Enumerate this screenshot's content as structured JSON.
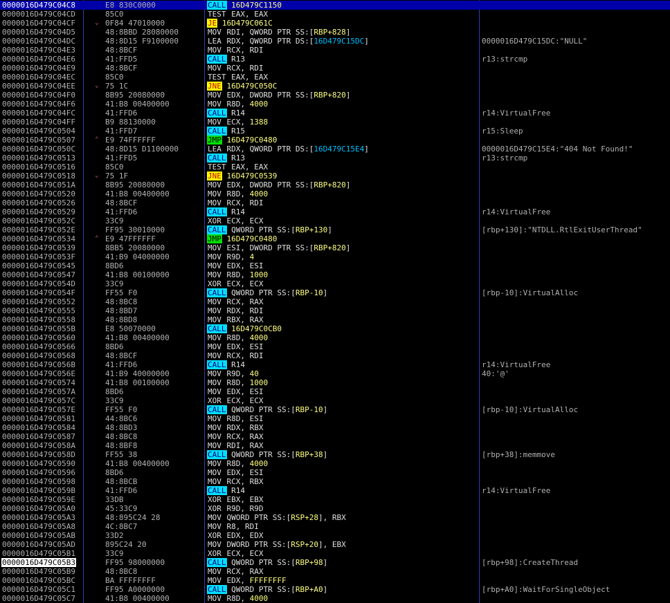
{
  "rows": [
    {
      "addr": "0000016D479C04C8",
      "arrow": "",
      "bytes": "E8 830C0000",
      "mn": "CALL",
      "mnType": "call",
      "ops": [
        {
          "t": "16D479C1150",
          "c": "jtgt"
        }
      ],
      "cmt": "",
      "selected": true
    },
    {
      "addr": "0000016D479C04CD",
      "arrow": "",
      "bytes": "85C0",
      "mn": "TEST",
      "mnType": "",
      "ops": [
        {
          "t": "EAX, EAX",
          "c": ""
        }
      ],
      "cmt": ""
    },
    {
      "addr": "0000016D479C04CF",
      "arrow": "v",
      "bytes": "0F84 47010000",
      "mn": "JE",
      "mnType": "jcc",
      "ops": [
        {
          "t": "16D479C061C",
          "c": "jtgt"
        }
      ],
      "cmt": ""
    },
    {
      "addr": "0000016D479C04D5",
      "arrow": "",
      "bytes": "48:8BBD 28080000",
      "mn": "MOV",
      "mnType": "",
      "ops": [
        {
          "t": "RDI, QWORD PTR SS:[",
          "c": ""
        },
        {
          "t": "RBP+828",
          "c": "num"
        },
        {
          "t": "]",
          "c": ""
        }
      ],
      "cmt": ""
    },
    {
      "addr": "0000016D479C04DC",
      "arrow": "",
      "bytes": "48:8D15 F9100000",
      "mn": "LEA",
      "mnType": "",
      "ops": [
        {
          "t": "RDX, QWORD PTR DS:[",
          "c": ""
        },
        {
          "t": "16D479C15DC",
          "c": "ref"
        },
        {
          "t": "]",
          "c": ""
        }
      ],
      "cmt": "0000016D479C15DC:\"NULL\""
    },
    {
      "addr": "0000016D479C04E3",
      "arrow": "",
      "bytes": "48:8BCF",
      "mn": "MOV",
      "mnType": "",
      "ops": [
        {
          "t": "RCX, RDI",
          "c": ""
        }
      ],
      "cmt": ""
    },
    {
      "addr": "0000016D479C04E6",
      "arrow": "",
      "bytes": "41:FFD5",
      "mn": "CALL",
      "mnType": "call",
      "ops": [
        {
          "t": "R13",
          "c": ""
        }
      ],
      "cmt": "r13:strcmp"
    },
    {
      "addr": "0000016D479C04E9",
      "arrow": "",
      "bytes": "48:8BCF",
      "mn": "MOV",
      "mnType": "",
      "ops": [
        {
          "t": "RCX, RDI",
          "c": ""
        }
      ],
      "cmt": ""
    },
    {
      "addr": "0000016D479C04EC",
      "arrow": "",
      "bytes": "85C0",
      "mn": "TEST",
      "mnType": "",
      "ops": [
        {
          "t": "EAX, EAX",
          "c": ""
        }
      ],
      "cmt": ""
    },
    {
      "addr": "0000016D479C04EE",
      "arrow": "v",
      "bytes": "75 1C",
      "mn": "JNE",
      "mnType": "jcc",
      "ops": [
        {
          "t": "16D479C050C",
          "c": "jtgt"
        }
      ],
      "cmt": ""
    },
    {
      "addr": "0000016D479C04F0",
      "arrow": "",
      "bytes": "8B95 20080000",
      "mn": "MOV",
      "mnType": "",
      "ops": [
        {
          "t": "EDX, DWORD PTR SS:[",
          "c": ""
        },
        {
          "t": "RBP+820",
          "c": "num"
        },
        {
          "t": "]",
          "c": ""
        }
      ],
      "cmt": ""
    },
    {
      "addr": "0000016D479C04F6",
      "arrow": "",
      "bytes": "41:B8 00400000",
      "mn": "MOV",
      "mnType": "",
      "ops": [
        {
          "t": "R8D, ",
          "c": ""
        },
        {
          "t": "4000",
          "c": "num"
        }
      ],
      "cmt": ""
    },
    {
      "addr": "0000016D479C04FC",
      "arrow": "",
      "bytes": "41:FFD6",
      "mn": "CALL",
      "mnType": "call",
      "ops": [
        {
          "t": "R14",
          "c": ""
        }
      ],
      "cmt": "r14:VirtualFree"
    },
    {
      "addr": "0000016D479C04FF",
      "arrow": "",
      "bytes": "B9 88130000",
      "mn": "MOV",
      "mnType": "",
      "ops": [
        {
          "t": "ECX, ",
          "c": ""
        },
        {
          "t": "1388",
          "c": "num"
        }
      ],
      "cmt": ""
    },
    {
      "addr": "0000016D479C0504",
      "arrow": "",
      "bytes": "41:FFD7",
      "mn": "CALL",
      "mnType": "call",
      "ops": [
        {
          "t": "R15",
          "c": ""
        }
      ],
      "cmt": "r15:Sleep"
    },
    {
      "addr": "0000016D479C0507",
      "arrow": "^",
      "bytes": "E9 74FFFFFF",
      "mn": "JMP",
      "mnType": "jmp",
      "ops": [
        {
          "t": "16D479C0480",
          "c": "jtgt"
        }
      ],
      "cmt": ""
    },
    {
      "addr": "0000016D479C050C",
      "arrow": "",
      "bytes": "48:8D15 D1100000",
      "mn": "LEA",
      "mnType": "",
      "ops": [
        {
          "t": "RDX, QWORD PTR DS:[",
          "c": ""
        },
        {
          "t": "16D479C15E4",
          "c": "ref"
        },
        {
          "t": "]",
          "c": ""
        }
      ],
      "cmt": "0000016D479C15E4:\"404 Not Found!\""
    },
    {
      "addr": "0000016D479C0513",
      "arrow": "",
      "bytes": "41:FFD5",
      "mn": "CALL",
      "mnType": "call",
      "ops": [
        {
          "t": "R13",
          "c": ""
        }
      ],
      "cmt": "r13:strcmp"
    },
    {
      "addr": "0000016D479C0516",
      "arrow": "",
      "bytes": "85C0",
      "mn": "TEST",
      "mnType": "",
      "ops": [
        {
          "t": "EAX, EAX",
          "c": ""
        }
      ],
      "cmt": ""
    },
    {
      "addr": "0000016D479C0518",
      "arrow": "v",
      "bytes": "75 1F",
      "mn": "JNE",
      "mnType": "jcc",
      "ops": [
        {
          "t": "16D479C0539",
          "c": "jtgt"
        }
      ],
      "cmt": ""
    },
    {
      "addr": "0000016D479C051A",
      "arrow": "",
      "bytes": "8B95 20080000",
      "mn": "MOV",
      "mnType": "",
      "ops": [
        {
          "t": "EDX, DWORD PTR SS:[",
          "c": ""
        },
        {
          "t": "RBP+820",
          "c": "num"
        },
        {
          "t": "]",
          "c": ""
        }
      ],
      "cmt": ""
    },
    {
      "addr": "0000016D479C0520",
      "arrow": "",
      "bytes": "41:B8 00400000",
      "mn": "MOV",
      "mnType": "",
      "ops": [
        {
          "t": "R8D, ",
          "c": ""
        },
        {
          "t": "4000",
          "c": "num"
        }
      ],
      "cmt": ""
    },
    {
      "addr": "0000016D479C0526",
      "arrow": "",
      "bytes": "48:8BCF",
      "mn": "MOV",
      "mnType": "",
      "ops": [
        {
          "t": "RCX, RDI",
          "c": ""
        }
      ],
      "cmt": ""
    },
    {
      "addr": "0000016D479C0529",
      "arrow": "",
      "bytes": "41:FFD6",
      "mn": "CALL",
      "mnType": "call",
      "ops": [
        {
          "t": "R14",
          "c": ""
        }
      ],
      "cmt": "r14:VirtualFree"
    },
    {
      "addr": "0000016D479C052C",
      "arrow": "",
      "bytes": "33C9",
      "mn": "XOR",
      "mnType": "",
      "ops": [
        {
          "t": "ECX, ECX",
          "c": ""
        }
      ],
      "cmt": ""
    },
    {
      "addr": "0000016D479C052E",
      "arrow": "",
      "bytes": "FF95 30010000",
      "mn": "CALL",
      "mnType": "call",
      "ops": [
        {
          "t": "QWORD PTR SS:[",
          "c": ""
        },
        {
          "t": "RBP+130",
          "c": "num"
        },
        {
          "t": "]",
          "c": ""
        }
      ],
      "cmt": "[rbp+130]:\"NTDLL.RtlExitUserThread\""
    },
    {
      "addr": "0000016D479C0534",
      "arrow": "^",
      "bytes": "E9 47FFFFFF",
      "mn": "JMP",
      "mnType": "jmp",
      "ops": [
        {
          "t": "16D479C0480",
          "c": "jtgt"
        }
      ],
      "cmt": ""
    },
    {
      "addr": "0000016D479C0539",
      "arrow": "",
      "bytes": "8BB5 20080000",
      "mn": "MOV",
      "mnType": "",
      "ops": [
        {
          "t": "ESI, DWORD PTR SS:[",
          "c": ""
        },
        {
          "t": "RBP+820",
          "c": "num"
        },
        {
          "t": "]",
          "c": ""
        }
      ],
      "cmt": ""
    },
    {
      "addr": "0000016D479C053F",
      "arrow": "",
      "bytes": "41:B9 04000000",
      "mn": "MOV",
      "mnType": "",
      "ops": [
        {
          "t": "R9D, ",
          "c": ""
        },
        {
          "t": "4",
          "c": "num"
        }
      ],
      "cmt": ""
    },
    {
      "addr": "0000016D479C0545",
      "arrow": "",
      "bytes": "8BD6",
      "mn": "MOV",
      "mnType": "",
      "ops": [
        {
          "t": "EDX, ESI",
          "c": ""
        }
      ],
      "cmt": ""
    },
    {
      "addr": "0000016D479C0547",
      "arrow": "",
      "bytes": "41:B8 00100000",
      "mn": "MOV",
      "mnType": "",
      "ops": [
        {
          "t": "R8D, ",
          "c": ""
        },
        {
          "t": "1000",
          "c": "num"
        }
      ],
      "cmt": ""
    },
    {
      "addr": "0000016D479C054D",
      "arrow": "",
      "bytes": "33C9",
      "mn": "XOR",
      "mnType": "",
      "ops": [
        {
          "t": "ECX, ECX",
          "c": ""
        }
      ],
      "cmt": ""
    },
    {
      "addr": "0000016D479C054F",
      "arrow": "",
      "bytes": "FF55 F0",
      "mn": "CALL",
      "mnType": "call",
      "ops": [
        {
          "t": "QWORD PTR SS:[",
          "c": ""
        },
        {
          "t": "RBP-10",
          "c": "num"
        },
        {
          "t": "]",
          "c": ""
        }
      ],
      "cmt": "[rbp-10]:VirtualAlloc"
    },
    {
      "addr": "0000016D479C0552",
      "arrow": "",
      "bytes": "48:8BC8",
      "mn": "MOV",
      "mnType": "",
      "ops": [
        {
          "t": "RCX, RAX",
          "c": ""
        }
      ],
      "cmt": ""
    },
    {
      "addr": "0000016D479C0555",
      "arrow": "",
      "bytes": "48:8BD7",
      "mn": "MOV",
      "mnType": "",
      "ops": [
        {
          "t": "RDX, RDI",
          "c": ""
        }
      ],
      "cmt": ""
    },
    {
      "addr": "0000016D479C0558",
      "arrow": "",
      "bytes": "48:8BD8",
      "mn": "MOV",
      "mnType": "",
      "ops": [
        {
          "t": "RBX, RAX",
          "c": ""
        }
      ],
      "cmt": ""
    },
    {
      "addr": "0000016D479C055B",
      "arrow": "",
      "bytes": "E8 50070000",
      "mn": "CALL",
      "mnType": "call",
      "ops": [
        {
          "t": "16D479C0CB0",
          "c": "jtgt"
        }
      ],
      "cmt": ""
    },
    {
      "addr": "0000016D479C0560",
      "arrow": "",
      "bytes": "41:B8 00400000",
      "mn": "MOV",
      "mnType": "",
      "ops": [
        {
          "t": "R8D, ",
          "c": ""
        },
        {
          "t": "4000",
          "c": "num"
        }
      ],
      "cmt": ""
    },
    {
      "addr": "0000016D479C0566",
      "arrow": "",
      "bytes": "8BD6",
      "mn": "MOV",
      "mnType": "",
      "ops": [
        {
          "t": "EDX, ESI",
          "c": ""
        }
      ],
      "cmt": ""
    },
    {
      "addr": "0000016D479C0568",
      "arrow": "",
      "bytes": "48:8BCF",
      "mn": "MOV",
      "mnType": "",
      "ops": [
        {
          "t": "RCX, RDI",
          "c": ""
        }
      ],
      "cmt": ""
    },
    {
      "addr": "0000016D479C056B",
      "arrow": "",
      "bytes": "41:FFD6",
      "mn": "CALL",
      "mnType": "call",
      "ops": [
        {
          "t": "R14",
          "c": ""
        }
      ],
      "cmt": "r14:VirtualFree"
    },
    {
      "addr": "0000016D479C056E",
      "arrow": "",
      "bytes": "41:B9 40000000",
      "mn": "MOV",
      "mnType": "",
      "ops": [
        {
          "t": "R9D, ",
          "c": ""
        },
        {
          "t": "40",
          "c": "num"
        }
      ],
      "cmt": "40:'@'"
    },
    {
      "addr": "0000016D479C0574",
      "arrow": "",
      "bytes": "41:B8 00100000",
      "mn": "MOV",
      "mnType": "",
      "ops": [
        {
          "t": "R8D, ",
          "c": ""
        },
        {
          "t": "1000",
          "c": "num"
        }
      ],
      "cmt": ""
    },
    {
      "addr": "0000016D479C057A",
      "arrow": "",
      "bytes": "8BD6",
      "mn": "MOV",
      "mnType": "",
      "ops": [
        {
          "t": "EDX, ESI",
          "c": ""
        }
      ],
      "cmt": ""
    },
    {
      "addr": "0000016D479C057C",
      "arrow": "",
      "bytes": "33C9",
      "mn": "XOR",
      "mnType": "",
      "ops": [
        {
          "t": "ECX, ECX",
          "c": ""
        }
      ],
      "cmt": ""
    },
    {
      "addr": "0000016D479C057E",
      "arrow": "",
      "bytes": "FF55 F0",
      "mn": "CALL",
      "mnType": "call",
      "ops": [
        {
          "t": "QWORD PTR SS:[",
          "c": ""
        },
        {
          "t": "RBP-10",
          "c": "num"
        },
        {
          "t": "]",
          "c": ""
        }
      ],
      "cmt": "[rbp-10]:VirtualAlloc"
    },
    {
      "addr": "0000016D479C0581",
      "arrow": "",
      "bytes": "44:8BC6",
      "mn": "MOV",
      "mnType": "",
      "ops": [
        {
          "t": "R8D, ESI",
          "c": ""
        }
      ],
      "cmt": ""
    },
    {
      "addr": "0000016D479C0584",
      "arrow": "",
      "bytes": "48:8BD3",
      "mn": "MOV",
      "mnType": "",
      "ops": [
        {
          "t": "RDX, RBX",
          "c": ""
        }
      ],
      "cmt": ""
    },
    {
      "addr": "0000016D479C0587",
      "arrow": "",
      "bytes": "48:8BC8",
      "mn": "MOV",
      "mnType": "",
      "ops": [
        {
          "t": "RCX, RAX",
          "c": ""
        }
      ],
      "cmt": ""
    },
    {
      "addr": "0000016D479C058A",
      "arrow": "",
      "bytes": "48:8BF8",
      "mn": "MOV",
      "mnType": "",
      "ops": [
        {
          "t": "RDI, RAX",
          "c": ""
        }
      ],
      "cmt": ""
    },
    {
      "addr": "0000016D479C058D",
      "arrow": "",
      "bytes": "FF55 38",
      "mn": "CALL",
      "mnType": "call",
      "ops": [
        {
          "t": "QWORD PTR SS:[",
          "c": ""
        },
        {
          "t": "RBP+38",
          "c": "num"
        },
        {
          "t": "]",
          "c": ""
        }
      ],
      "cmt": "[rbp+38]:memmove"
    },
    {
      "addr": "0000016D479C0590",
      "arrow": "",
      "bytes": "41:B8 00400000",
      "mn": "MOV",
      "mnType": "",
      "ops": [
        {
          "t": "R8D, ",
          "c": ""
        },
        {
          "t": "4000",
          "c": "num"
        }
      ],
      "cmt": ""
    },
    {
      "addr": "0000016D479C0596",
      "arrow": "",
      "bytes": "8BD6",
      "mn": "MOV",
      "mnType": "",
      "ops": [
        {
          "t": "EDX, ESI",
          "c": ""
        }
      ],
      "cmt": ""
    },
    {
      "addr": "0000016D479C0598",
      "arrow": "",
      "bytes": "48:8BCB",
      "mn": "MOV",
      "mnType": "",
      "ops": [
        {
          "t": "RCX, RBX",
          "c": ""
        }
      ],
      "cmt": ""
    },
    {
      "addr": "0000016D479C059B",
      "arrow": "",
      "bytes": "41:FFD6",
      "mn": "CALL",
      "mnType": "call",
      "ops": [
        {
          "t": "R14",
          "c": ""
        }
      ],
      "cmt": "r14:VirtualFree"
    },
    {
      "addr": "0000016D479C059E",
      "arrow": "",
      "bytes": "33DB",
      "mn": "XOR",
      "mnType": "",
      "ops": [
        {
          "t": "EBX, EBX",
          "c": ""
        }
      ],
      "cmt": ""
    },
    {
      "addr": "0000016D479C05A0",
      "arrow": "",
      "bytes": "45:33C9",
      "mn": "XOR",
      "mnType": "",
      "ops": [
        {
          "t": "R9D, R9D",
          "c": ""
        }
      ],
      "cmt": ""
    },
    {
      "addr": "0000016D479C05A3",
      "arrow": "",
      "bytes": "48:895C24 28",
      "mn": "MOV",
      "mnType": "",
      "ops": [
        {
          "t": "QWORD PTR SS:[",
          "c": ""
        },
        {
          "t": "RSP+28",
          "c": "num"
        },
        {
          "t": "], RBX",
          "c": ""
        }
      ],
      "cmt": ""
    },
    {
      "addr": "0000016D479C05A8",
      "arrow": "",
      "bytes": "4C:8BC7",
      "mn": "MOV",
      "mnType": "",
      "ops": [
        {
          "t": "R8, RDI",
          "c": ""
        }
      ],
      "cmt": ""
    },
    {
      "addr": "0000016D479C05AB",
      "arrow": "",
      "bytes": "33D2",
      "mn": "XOR",
      "mnType": "",
      "ops": [
        {
          "t": "EDX, EDX",
          "c": ""
        }
      ],
      "cmt": ""
    },
    {
      "addr": "0000016D479C05AD",
      "arrow": "",
      "bytes": "895C24 20",
      "mn": "MOV",
      "mnType": "",
      "ops": [
        {
          "t": "DWORD PTR SS:[",
          "c": ""
        },
        {
          "t": "RSP+20",
          "c": "num"
        },
        {
          "t": "], EBX",
          "c": ""
        }
      ],
      "cmt": ""
    },
    {
      "addr": "0000016D479C05B1",
      "arrow": "",
      "bytes": "33C9",
      "mn": "XOR",
      "mnType": "",
      "ops": [
        {
          "t": "ECX, ECX",
          "c": ""
        }
      ],
      "cmt": ""
    },
    {
      "addr": "0000016D479C05B3",
      "arrow": "",
      "bytes": "FF95 98000000",
      "mn": "CALL",
      "mnType": "call",
      "ops": [
        {
          "t": "QWORD PTR SS:[",
          "c": ""
        },
        {
          "t": "RBP+98",
          "c": "num"
        },
        {
          "t": "]",
          "c": ""
        }
      ],
      "cmt": "[rbp+98]:CreateThread",
      "boxed": true
    },
    {
      "addr": "0000016D479C05B9",
      "arrow": "",
      "bytes": "48:8BC8",
      "mn": "MOV",
      "mnType": "",
      "ops": [
        {
          "t": "RCX, RAX",
          "c": ""
        }
      ],
      "cmt": ""
    },
    {
      "addr": "0000016D479C05BC",
      "arrow": "",
      "bytes": "BA FFFFFFFF",
      "mn": "MOV",
      "mnType": "",
      "ops": [
        {
          "t": "EDX, ",
          "c": ""
        },
        {
          "t": "FFFFFFFF",
          "c": "num"
        }
      ],
      "cmt": ""
    },
    {
      "addr": "0000016D479C05C1",
      "arrow": "",
      "bytes": "FF95 A0000000",
      "mn": "CALL",
      "mnType": "call",
      "ops": [
        {
          "t": "QWORD PTR SS:[",
          "c": ""
        },
        {
          "t": "RBP+A0",
          "c": "num"
        },
        {
          "t": "]",
          "c": ""
        }
      ],
      "cmt": "[rbp+A0]:WaitForSingleObject"
    },
    {
      "addr": "0000016D479C05C7",
      "arrow": "",
      "bytes": "41:B8 00400000",
      "mn": "MOV",
      "mnType": "",
      "ops": [
        {
          "t": "R8D, ",
          "c": ""
        },
        {
          "t": "4000",
          "c": "num"
        }
      ],
      "cmt": ""
    }
  ]
}
